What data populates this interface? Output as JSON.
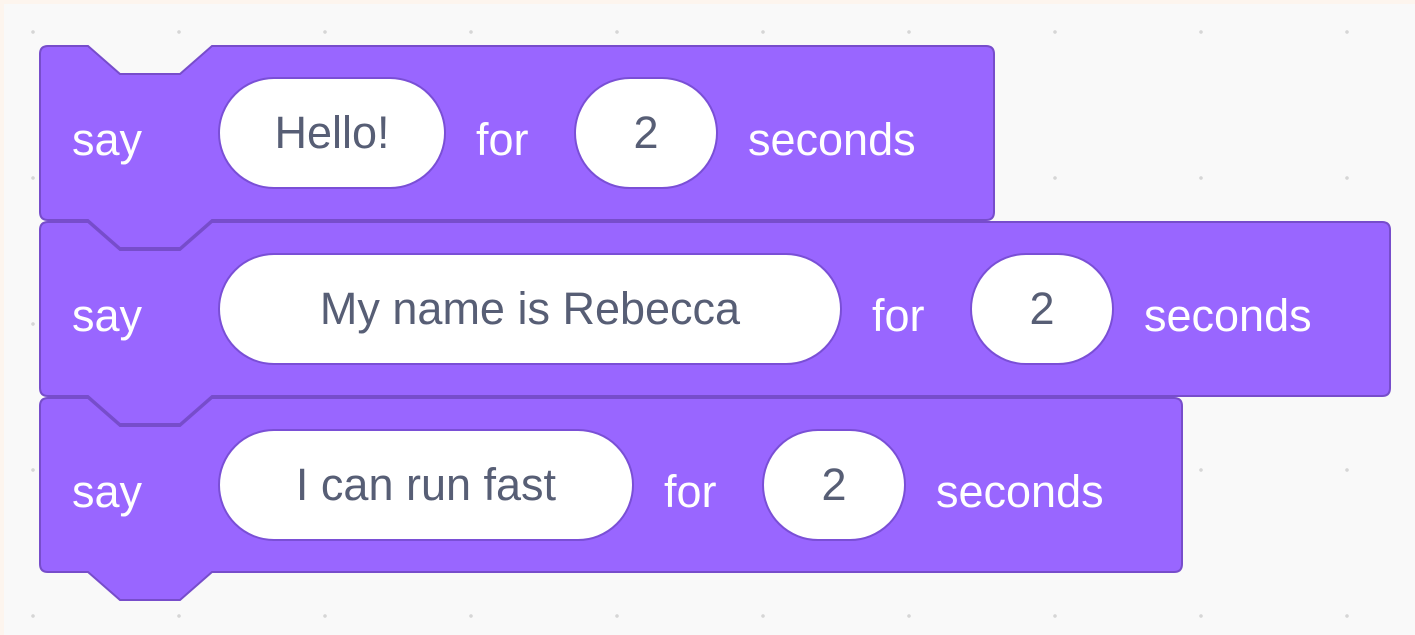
{
  "colors": {
    "block_fill": "#9966ff",
    "block_border": "#774dcb",
    "slot_fill": "#ffffff",
    "slot_text": "#575e75",
    "label_text": "#ffffff",
    "workspace_bg": "#f9f9f9"
  },
  "blocks": [
    {
      "keyword": "say",
      "message": "Hello!",
      "for_label": "for",
      "secs": "2",
      "unit": "seconds"
    },
    {
      "keyword": "say",
      "message": "My name is Rebecca",
      "for_label": "for",
      "secs": "2",
      "unit": "seconds"
    },
    {
      "keyword": "say",
      "message": "I can run fast",
      "for_label": "for",
      "secs": "2",
      "unit": "seconds"
    }
  ]
}
